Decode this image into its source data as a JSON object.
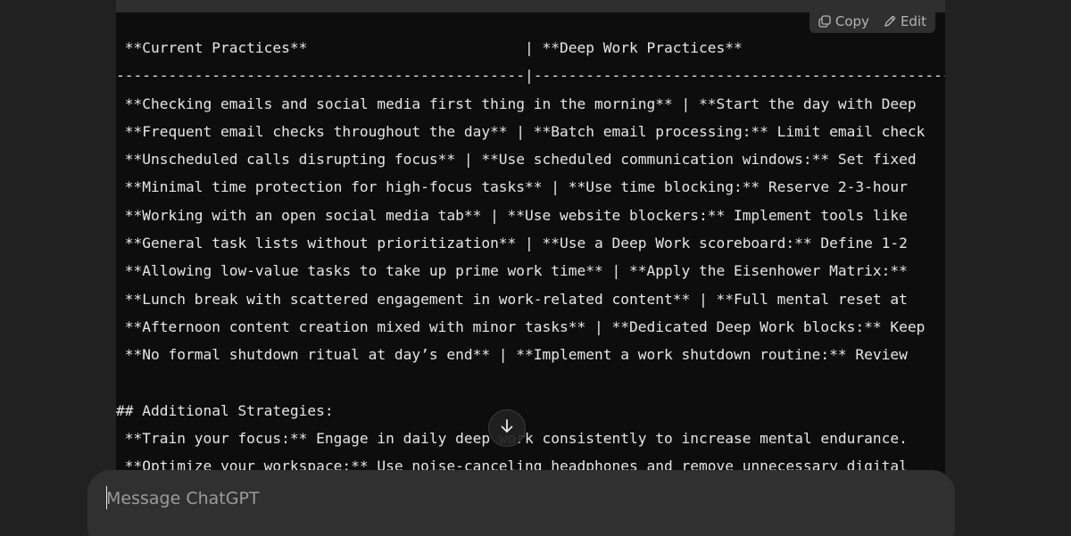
{
  "code_block": {
    "actions": {
      "copy_label": "Copy",
      "edit_label": "Edit"
    },
    "lines": [
      " **Current Practices**                         | **Deep Work Practices**",
      "-----------------------------------------------|---------------------------------------------------------------",
      " **Checking emails and social media first thing in the morning** | **Start the day with Deep",
      " **Frequent email checks throughout the day** | **Batch email processing:** Limit email check",
      " **Unscheduled calls disrupting focus** | **Use scheduled communication windows:** Set fixed",
      " **Minimal time protection for high-focus tasks** | **Use time blocking:** Reserve 2-3-hour",
      " **Working with an open social media tab** | **Use website blockers:** Implement tools like",
      " **General task lists without prioritization** | **Use a Deep Work scoreboard:** Define 1-2",
      " **Allowing low-value tasks to take up prime work time** | **Apply the Eisenhower Matrix:**",
      " **Lunch break with scattered engagement in work-related content** | **Full mental reset at",
      " **Afternoon content creation mixed with minor tasks** | **Dedicated Deep Work blocks:** Keep",
      " **No formal shutdown ritual at day’s end** | **Implement a work shutdown routine:** Review",
      "",
      "## Additional Strategies:",
      " **Train your focus:** Engage in daily deep work consistently to increase mental endurance.",
      " **Optimize your workspace:** Use noise-canceling headphones and remove unnecessary digital"
    ]
  },
  "composer": {
    "placeholder": "Message ChatGPT"
  },
  "icons": {
    "copy": "copy-icon",
    "edit": "pencil-icon",
    "scroll": "arrow-down-icon"
  }
}
